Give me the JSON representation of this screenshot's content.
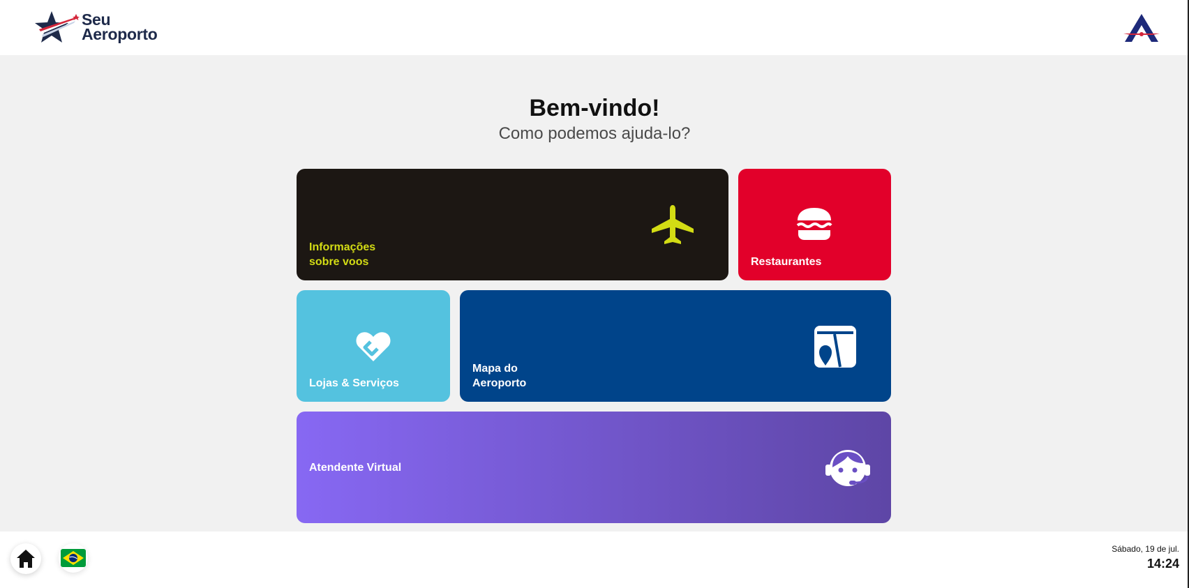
{
  "header": {
    "brand_line1": "Seu",
    "brand_line2": "Aeroporto",
    "logo_icon": "star-plane-logo-icon",
    "partner_icon": "airline-a-logo-icon"
  },
  "welcome": {
    "title": "Bem-vindo!",
    "subtitle": "Como podemos ajuda-lo?"
  },
  "tiles": [
    {
      "id": "flights",
      "label": "Informações\nsobre voos",
      "icon": "airplane-icon",
      "color": "#1c1713",
      "label_color": "#d3dc14"
    },
    {
      "id": "restaurants",
      "label": "Restaurantes",
      "icon": "burger-icon",
      "color": "#e2002a"
    },
    {
      "id": "shops",
      "label": "Lojas & Serviços",
      "icon": "shopping-heart-icon",
      "color": "#54c2df"
    },
    {
      "id": "map",
      "label": "Mapa do\nAeroporto",
      "icon": "map-pin-icon",
      "color": "#00448a"
    },
    {
      "id": "virtual",
      "label": "Atendente Virtual",
      "icon": "headset-agent-icon",
      "color_start": "#8768f3",
      "color_end": "#5e46a6"
    }
  ],
  "footer": {
    "home_icon": "home-icon",
    "language_icon": "brazil-flag-icon",
    "date": "Sábado, 19 de jul.",
    "time": "14:24"
  }
}
